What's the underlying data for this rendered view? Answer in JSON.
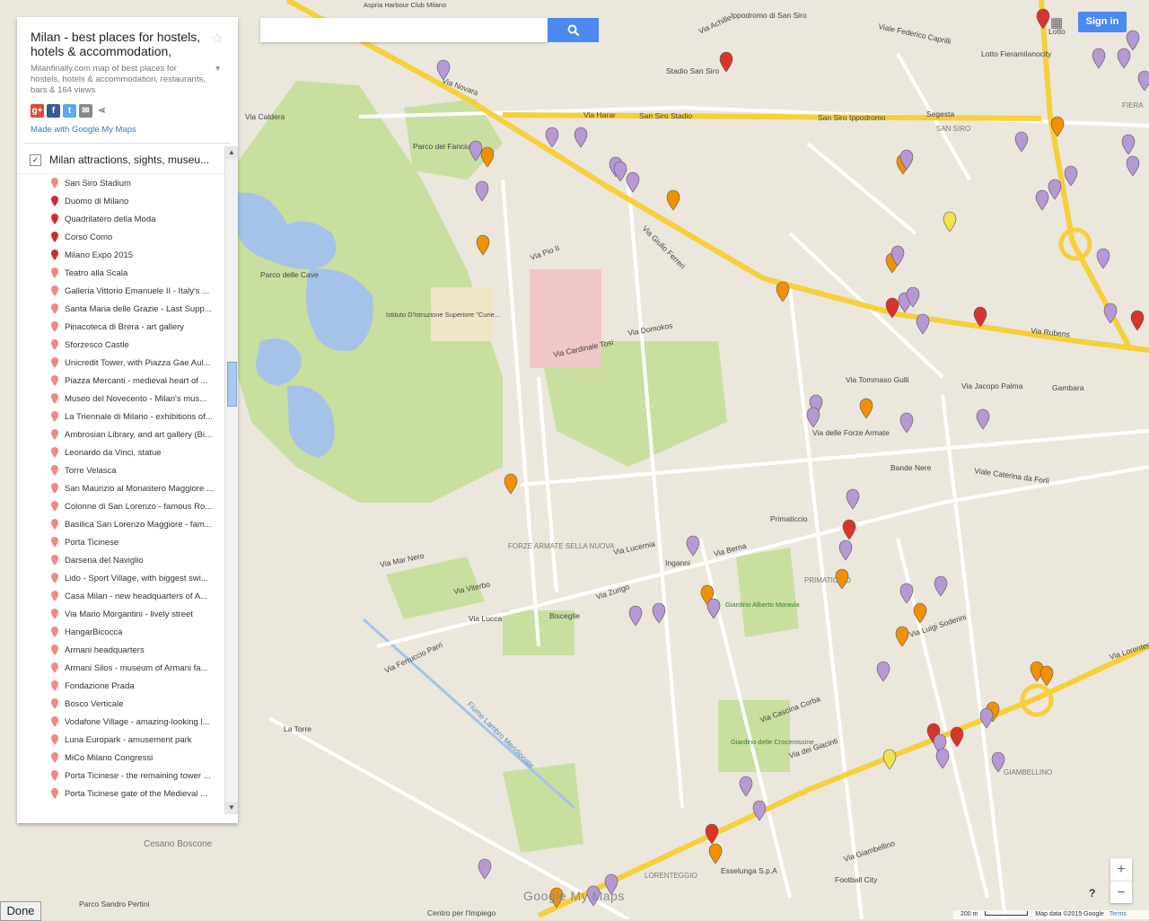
{
  "map_title": "Milan - best places for hostels, hotels & accommodation,",
  "map_description": "Milanfinally.com map of best places for hostels, hotels & accommodation, restaurants, bars & 164 views",
  "made_with": "Made with Google My Maps",
  "layer_name": "Milan attractions, sights, museu...",
  "places": [
    "San Siro Stadium",
    "Duomo di Milano",
    "Quadrilatero della Moda",
    "Corso Como",
    "Milano Expo 2015",
    "Teatro alla Scala",
    "Galleria Vittorio Emanuele II - Italy's ...",
    "Santa Maria delle Grazie - Last Supp...",
    "Pinacoteca di Brera - art gallery",
    "Sforzesco Castle",
    "Unicredit Tower, with Piazza Gae Aul...",
    "Piazza Mercanti - medieval heart of ...",
    "Museo del Novecento - Milan's mus...",
    "La Triennale di Milano - exhibitions of...",
    "Ambrosian Library, and art gallery (Bi...",
    "Leonardo da Vinci, statue",
    "Torre Velasca",
    "San Maurizio al Monastero Maggiore ...",
    "Colonne di San Lorenzo - famous Ro...",
    "Basilica San Lorenzo Maggiore - fam...",
    "Porta Ticinese",
    "Darsena del Naviglio",
    "Lido - Sport Village, with biggest swi...",
    "Casa Milan - new headquarters of A...",
    "Via Mario Morgantini - lively street",
    "HangarBicocca",
    "Armani headquarters",
    "Armani Silos - museum of Armani fa...",
    "Fondazione Prada",
    "Bosco Verticale",
    "Vodafone Village - amazing-looking l...",
    "Luna Europark - amusement park",
    "MiCo Milano Congressi",
    "Porta Ticinese - the remaining tower ...",
    "Porta Ticinese gate of the Medieval ..."
  ],
  "map_labels": {
    "streets": [
      "Via Novara",
      "Via Harar",
      "Via Caldera",
      "Via Achille",
      "Viale Federico Caprilli",
      "Via Rubens",
      "Via delle Forze Armate",
      "Via Lucca",
      "Via Zurigo",
      "Via Berna",
      "Via Lucernia",
      "Via Tommaso Gulli",
      "Via Jacopo Palma",
      "Via Mar Nero",
      "Via Viterbo",
      "Via Ferruccio Parri",
      "Via Luigi Soderini",
      "Via Lorenteggio",
      "Via Giambellino",
      "Via dei Giacinti",
      "Via Domokos",
      "Via Cardinale Tosi",
      "Via Pio II",
      "Via Giulio Ferreri",
      "Viale Caterina da Forlì",
      "Via Cascina Corba"
    ],
    "places": [
      "Parco delle Cave",
      "Parco del Fanciullo",
      "Istituto D'Istruzione Superiore \"Curie...",
      "Stadio San Siro",
      "Ippodromo di San Siro",
      "San Siro Stadio",
      "San Siro Ippodromo",
      "Segesta",
      "Lotto Fieramilanocity",
      "Lotto",
      "Bande Nere",
      "Primaticcio",
      "Inganni",
      "Bisceglie",
      "Gambara",
      "FORZE ARMATE SELLA NUOVA",
      "PRIMATICCIO",
      "Giardino Alberto Moravia",
      "Giardino delle Crocerossine",
      "GIAMBELLINO",
      "LORENTEGGIO",
      "Esselunga S.p.A",
      "Football City",
      "La Torre",
      "Cesano Boscone",
      "Parco Sandro Pertini",
      "Centro per l'Impiego",
      "SAN SIRO",
      "FIERA",
      "Aspria Harbour Club Milano",
      "Fiume Lambro Meridionale"
    ]
  },
  "sign_in_label": "Sign in",
  "zoom_in": "+",
  "zoom_out": "−",
  "help_label": "?",
  "done_label": "Done",
  "watermark": "Google My Maps",
  "scale_label": "200 m",
  "map_data": "Map data ©2015 Google",
  "terms": "Terms",
  "colors": {
    "accent": "#4a89ef",
    "pin_red": "#d9342b",
    "pin_purple": "#b698d4",
    "pin_orange": "#f29100",
    "pin_yellow": "#f2e24e",
    "road_major": "#f6cf3a",
    "park": "#c8df9f",
    "water": "#a5c2e9"
  }
}
